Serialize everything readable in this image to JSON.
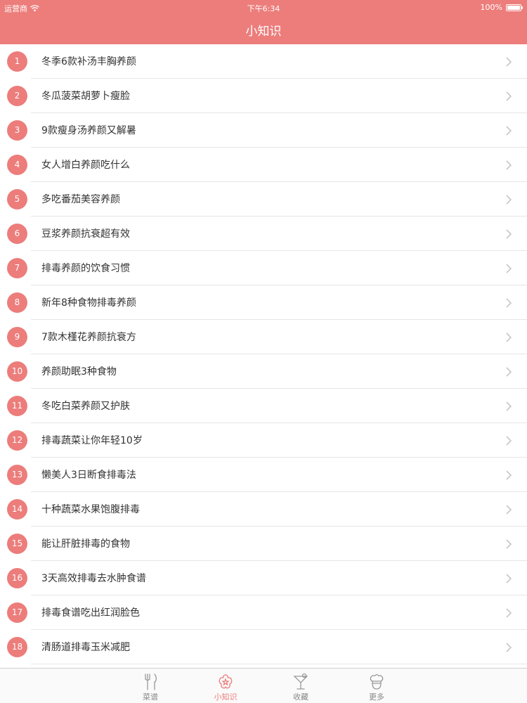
{
  "status_bar": {
    "carrier": "运营商",
    "time": "下午6:34",
    "battery": "100%",
    "battery_level": 1.0
  },
  "nav": {
    "title": "小知识"
  },
  "items": [
    {
      "num": "1",
      "title": "冬季6款补汤丰胸养颜"
    },
    {
      "num": "2",
      "title": "冬瓜菠菜胡萝卜瘦脸"
    },
    {
      "num": "3",
      "title": "9款瘦身汤养颜又解暑"
    },
    {
      "num": "4",
      "title": "女人增白养颜吃什么"
    },
    {
      "num": "5",
      "title": "多吃番茄美容养颜"
    },
    {
      "num": "6",
      "title": "豆浆养颜抗衰超有效"
    },
    {
      "num": "7",
      "title": "排毒养颜的饮食习惯"
    },
    {
      "num": "8",
      "title": "新年8种食物排毒养颜"
    },
    {
      "num": "9",
      "title": "7款木槿花养颜抗衰方"
    },
    {
      "num": "10",
      "title": "养颜助眠3种食物"
    },
    {
      "num": "11",
      "title": "冬吃白菜养颜又护肤"
    },
    {
      "num": "12",
      "title": "排毒蔬菜让你年轻10岁"
    },
    {
      "num": "13",
      "title": "懒美人3日断食排毒法"
    },
    {
      "num": "14",
      "title": "十种蔬菜水果饱腹排毒"
    },
    {
      "num": "15",
      "title": "能让肝脏排毒的食物"
    },
    {
      "num": "16",
      "title": "3天高效排毒去水肿食谱"
    },
    {
      "num": "17",
      "title": "排毒食谱吃出红润脸色"
    },
    {
      "num": "18",
      "title": "清肠道排毒玉米减肥"
    }
  ],
  "tabs": [
    {
      "label": "菜谱",
      "icon": "fork-knife-icon",
      "active": false
    },
    {
      "label": "小知识",
      "icon": "flower-icon",
      "active": true
    },
    {
      "label": "收藏",
      "icon": "cocktail-icon",
      "active": false
    },
    {
      "label": "更多",
      "icon": "chef-hat-icon",
      "active": false
    }
  ],
  "colors": {
    "accent": "#ec7d7b",
    "tab_inactive": "#888888",
    "separator": "#e6e6e6"
  }
}
